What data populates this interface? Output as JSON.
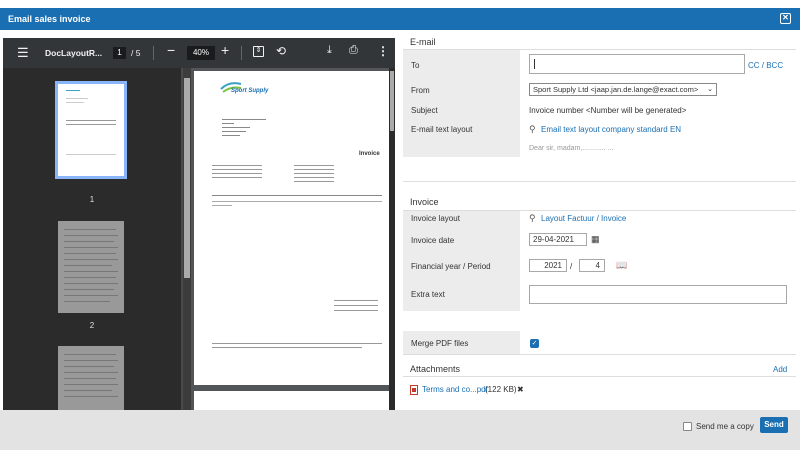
{
  "dialog": {
    "title": "Email sales invoice"
  },
  "pdf": {
    "filename": "DocLayoutR...",
    "page_current": "1",
    "page_total": "/ 5",
    "zoom": "40%",
    "thumb_labels": [
      "1",
      "2"
    ],
    "invoice_heading": "Invoice",
    "logo_text": "Sport Supply"
  },
  "email": {
    "section": "E-mail",
    "to_label": "To",
    "to_value": "",
    "cc_bcc": "CC / BCC",
    "from_label": "From",
    "from_value": "Sport Supply Ltd <jaap.jan.de.lange@exact.com>",
    "subject_label": "Subject",
    "subject_value": "Invoice number <Number will be generated>",
    "layout_label": "E-mail text layout",
    "layout_value": "Email text layout company standard EN",
    "body_preview": "Dear sir, madam,............ ..."
  },
  "invoice": {
    "section": "Invoice",
    "layout_label": "Invoice layout",
    "layout_value": "Layout Factuur / Invoice",
    "date_label": "Invoice date",
    "date_value": "29-04-2021",
    "period_label": "Financial year / Period",
    "year_value": "2021",
    "slash": "/",
    "period_value": "4",
    "extra_label": "Extra text",
    "extra_value": ""
  },
  "merge": {
    "label": "Merge PDF files",
    "checked": true
  },
  "attachments": {
    "title": "Attachments",
    "add": "Add",
    "file_name": "Terms and co...pdf",
    "file_size": "(122 KB)"
  },
  "footer": {
    "send_copy": "Send me a copy",
    "send": "Send"
  },
  "colors": {
    "accent": "#1a6fb3",
    "pdf_toolbar": "#333639"
  }
}
